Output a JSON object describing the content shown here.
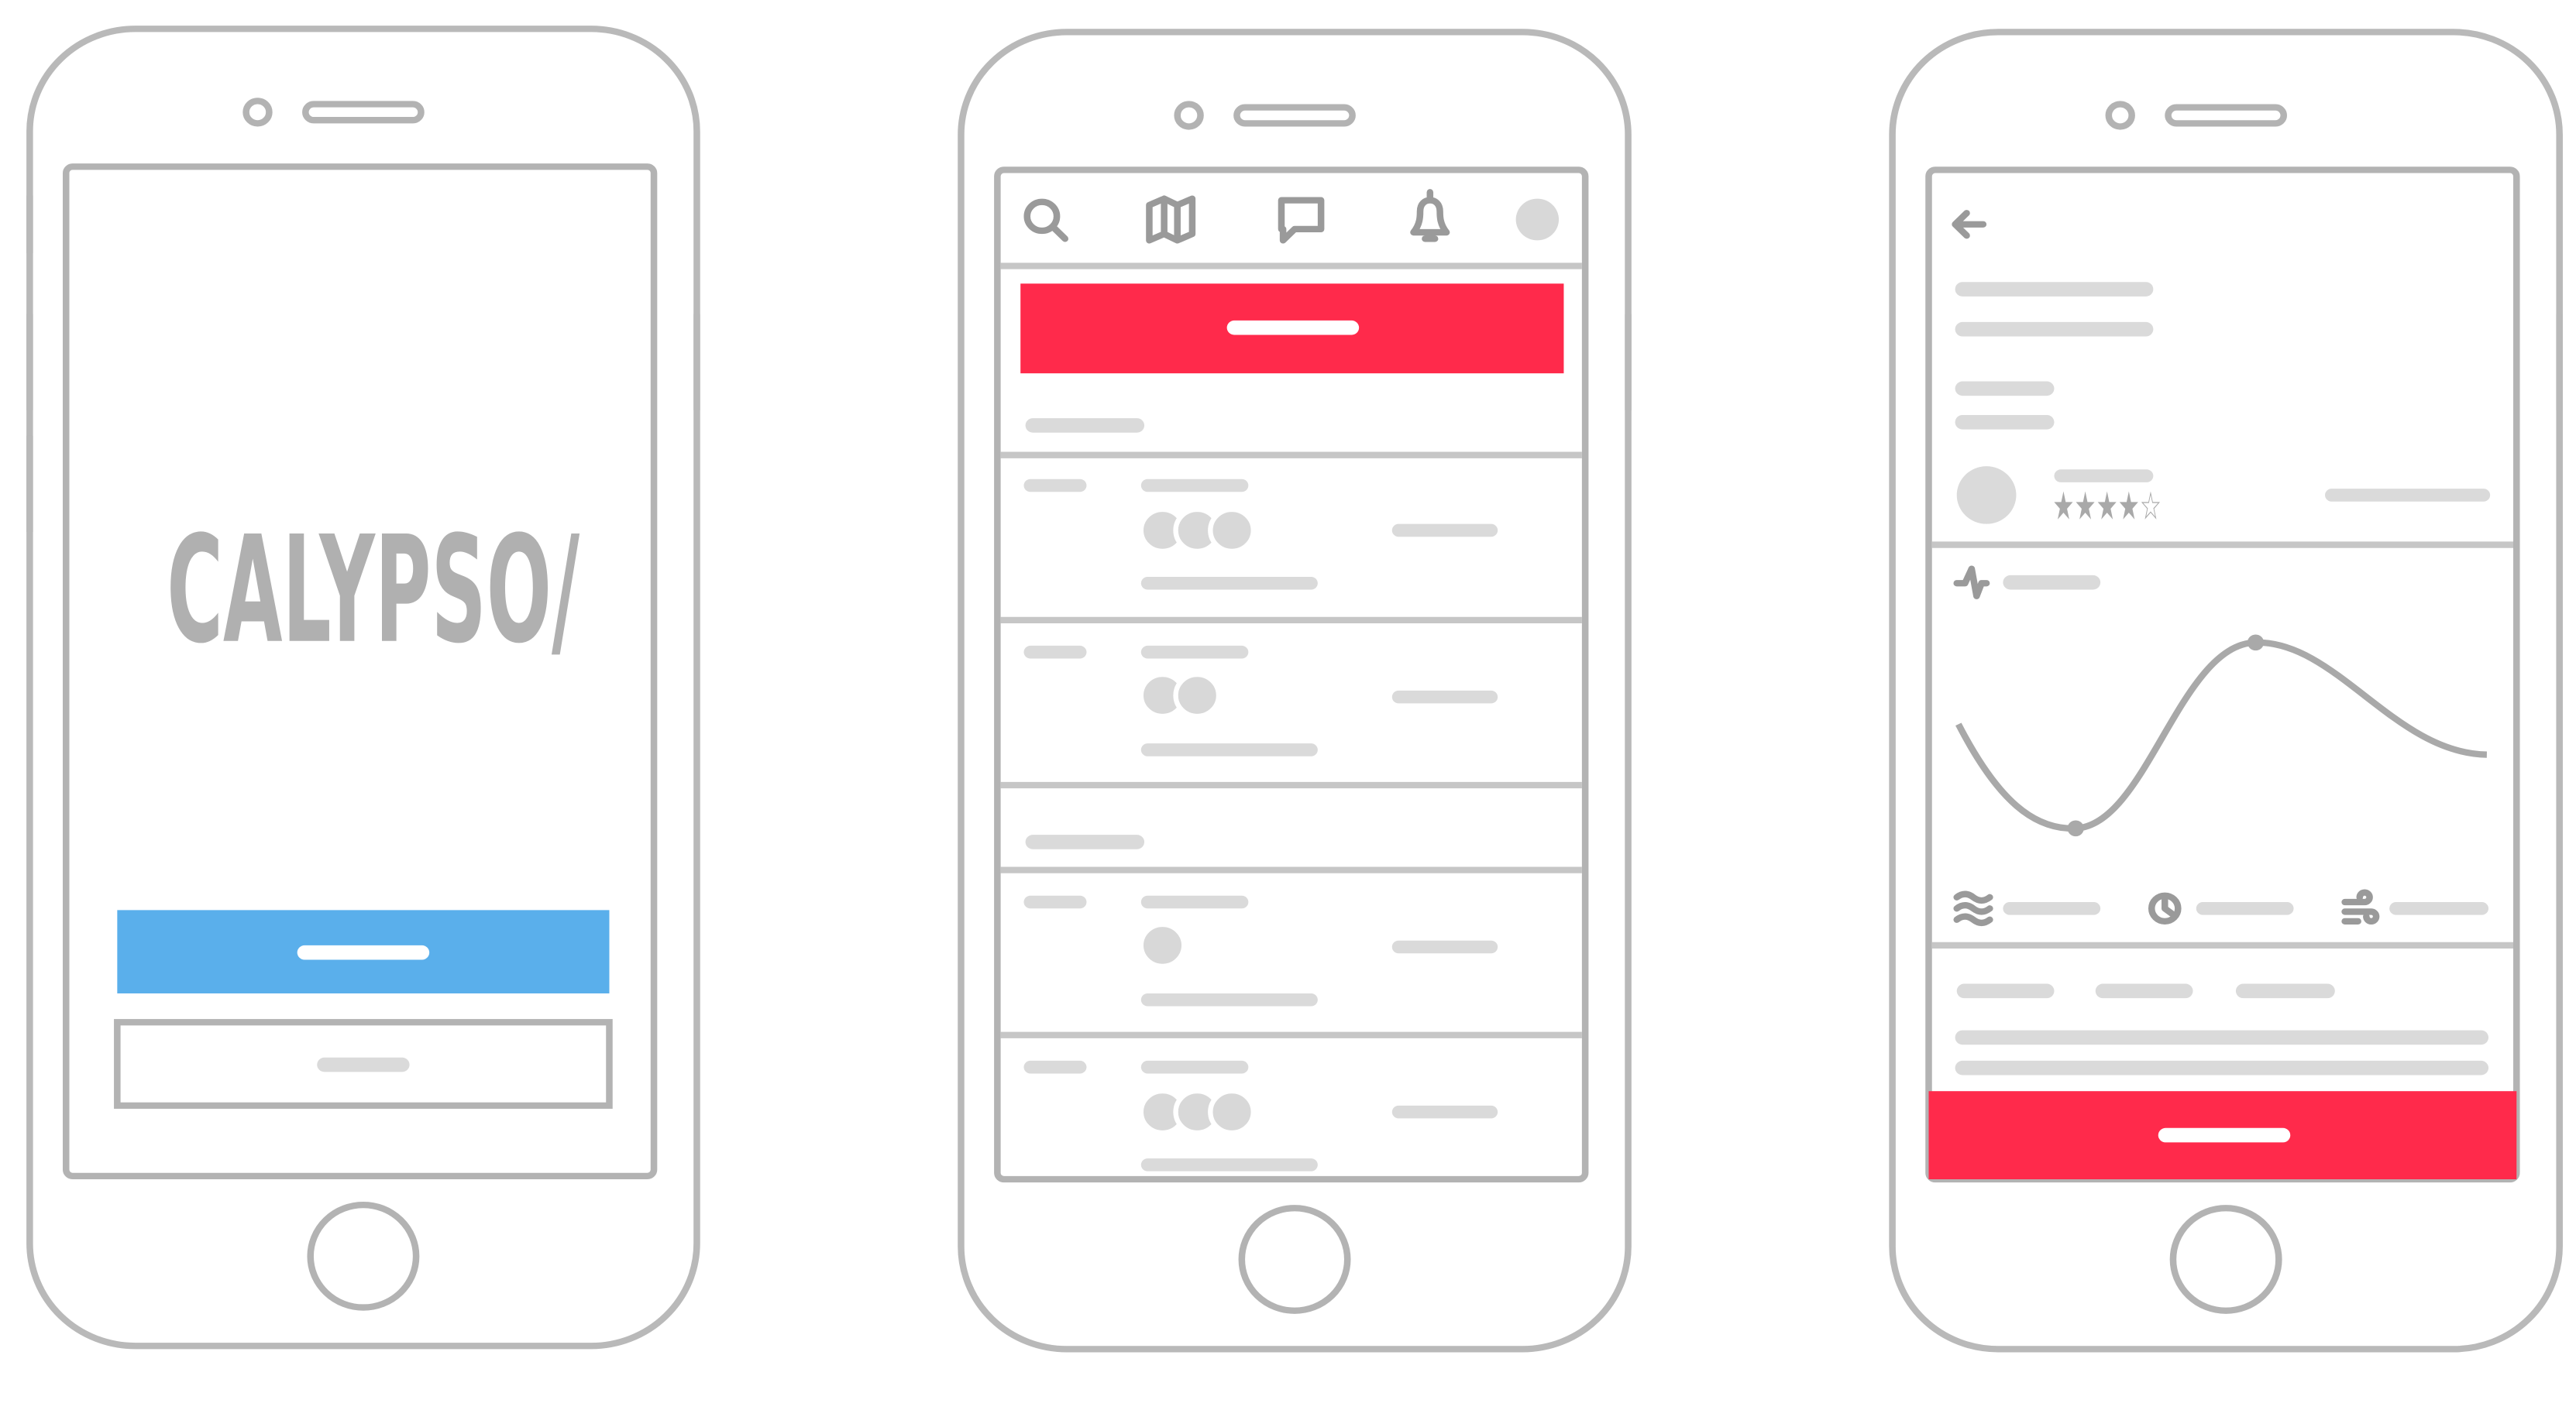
{
  "colors": {
    "primary_blue": "#5AAFEB",
    "accent_red": "#FF2A4B",
    "outline_gray": "#B3B3B3",
    "placeholder_gray": "#DADADA"
  },
  "screens": [
    {
      "id": "welcome",
      "logo_text": "CALYPSO/",
      "primary_button": "placeholder",
      "secondary_button": "placeholder"
    },
    {
      "id": "list",
      "nav_icons": [
        "search-icon",
        "map-icon",
        "chat-icon",
        "bell-icon",
        "avatar"
      ],
      "cta_button": "placeholder",
      "sections": [
        {
          "rows": [
            {
              "participants": 3
            },
            {
              "participants": 2
            }
          ]
        },
        {
          "rows": [
            {
              "participants": 1
            },
            {
              "participants": 3
            }
          ]
        }
      ]
    },
    {
      "id": "detail",
      "back_icon": "arrow-left-icon",
      "rating": {
        "value": 4,
        "max": 5,
        "stars_text": "★★★★☆"
      },
      "metric_icons": [
        "waves-icon",
        "clock-icon",
        "wind-icon"
      ],
      "chart_icon": "activity-icon",
      "cta_button": "placeholder"
    }
  ]
}
